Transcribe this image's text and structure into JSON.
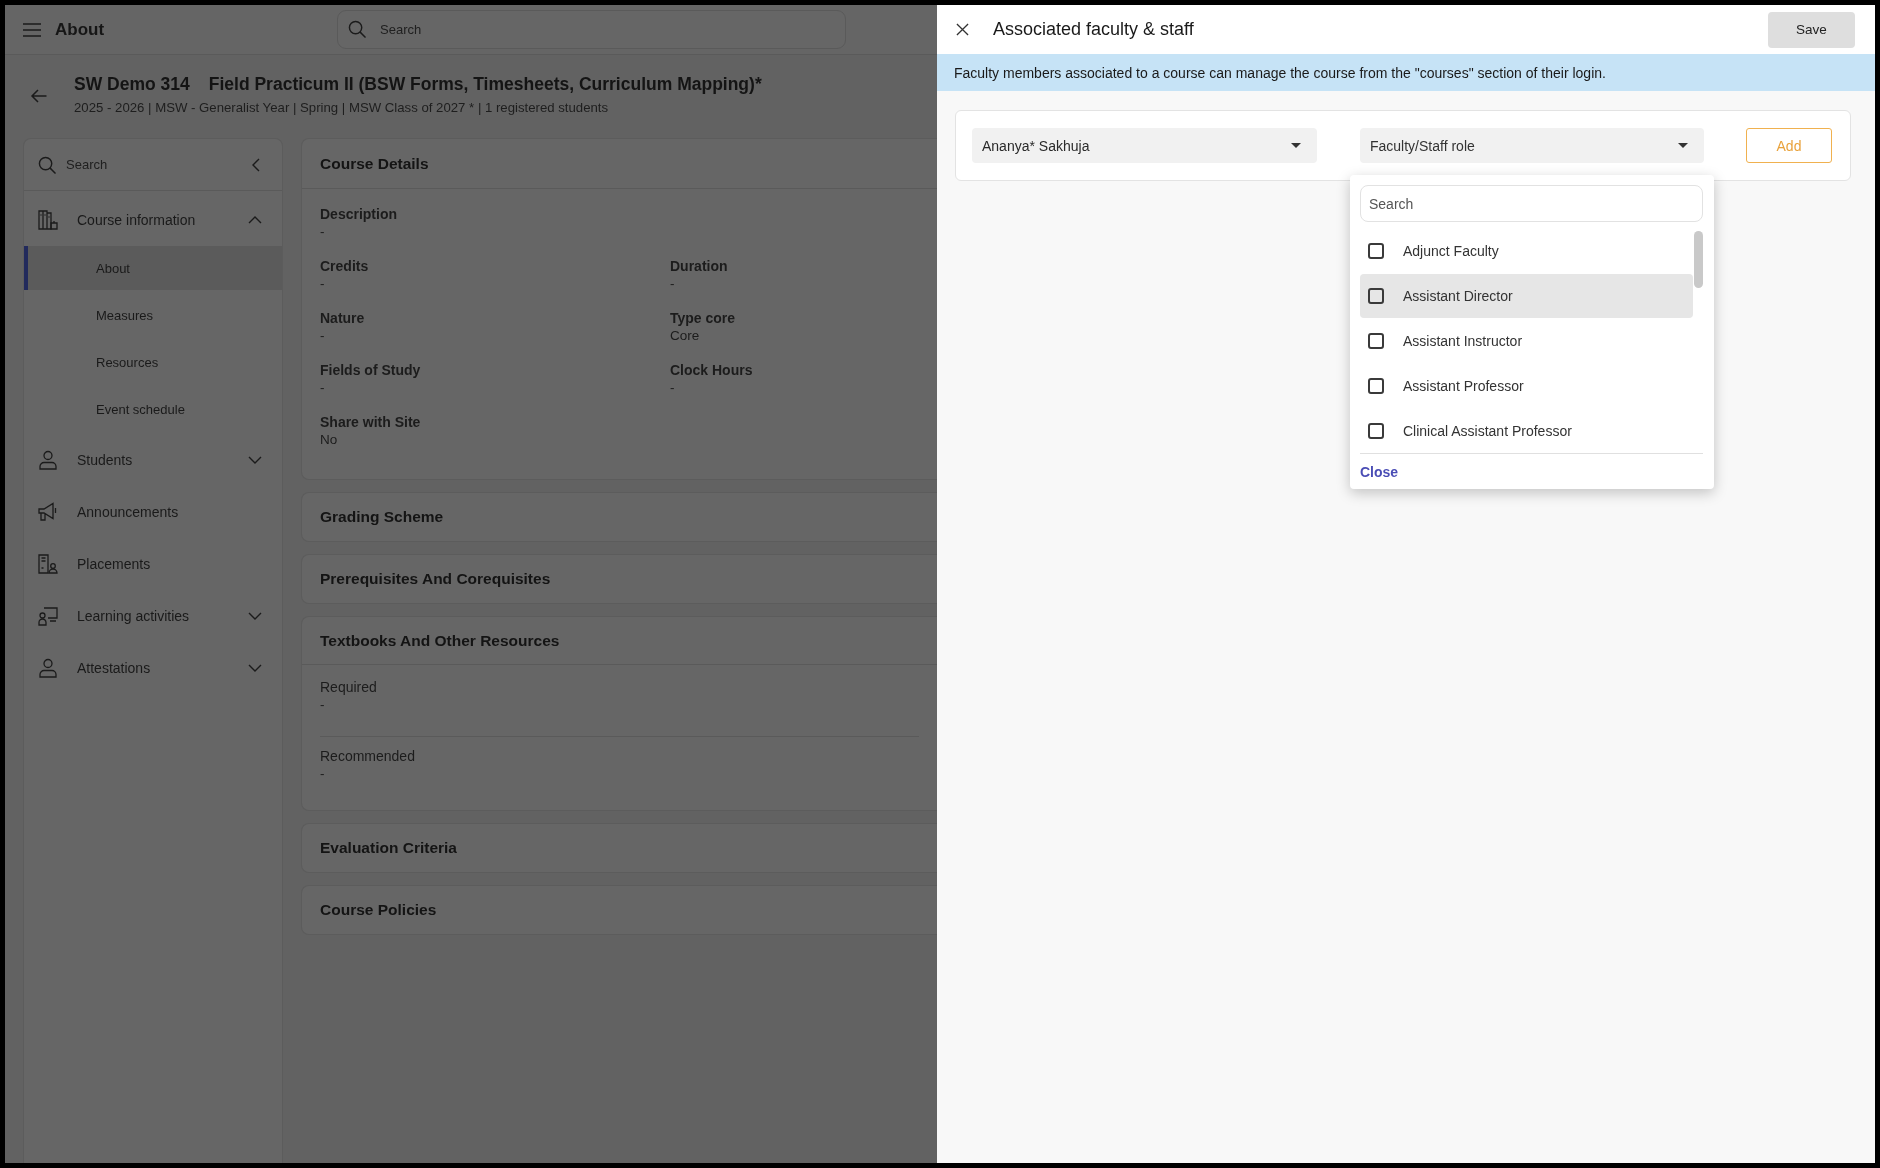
{
  "top_bar": {
    "title": "About",
    "search": {
      "placeholder": "Search"
    }
  },
  "course_header": {
    "code": "SW Demo 314",
    "title": "Field Practicum II (BSW Forms, Timesheets, Curriculum Mapping)*",
    "meta": "2025 - 2026 | MSW - Generalist Year | Spring | MSW Class of 2027 * | 1 registered students"
  },
  "sidebar": {
    "search": {
      "placeholder": "Search"
    },
    "items": [
      {
        "kind": "group",
        "label": "Course information",
        "expanded": true,
        "children": [
          {
            "label": "About",
            "selected": true
          },
          {
            "label": "Measures",
            "selected": false
          },
          {
            "label": "Resources",
            "selected": false
          },
          {
            "label": "Event schedule",
            "selected": false
          }
        ]
      },
      {
        "kind": "group",
        "label": "Students",
        "expanded": false
      },
      {
        "kind": "link",
        "label": "Announcements"
      },
      {
        "kind": "link",
        "label": "Placements"
      },
      {
        "kind": "group",
        "label": "Learning activities",
        "expanded": false
      },
      {
        "kind": "group",
        "label": "Attestations",
        "expanded": false
      }
    ]
  },
  "sections": [
    {
      "kind": "details",
      "title": "Course Details",
      "description": {
        "label": "Description",
        "value": "-"
      },
      "fields": [
        {
          "label": "Credits",
          "value": "-"
        },
        {
          "label": "Duration",
          "value": "-"
        },
        {
          "label": "Nature",
          "value": "-"
        },
        {
          "label": "Type core",
          "value": "Core"
        },
        {
          "label": "Fields of Study",
          "value": "-"
        },
        {
          "label": "Clock Hours",
          "value": "-"
        },
        {
          "label": "Share with Site",
          "value": "No"
        }
      ]
    },
    {
      "kind": "collapsed",
      "title": "Grading Scheme"
    },
    {
      "kind": "collapsed",
      "title": "Prerequisites And Corequisites"
    },
    {
      "kind": "resources",
      "title": "Textbooks And Other Resources",
      "fields": [
        {
          "label": "Required",
          "value": "-"
        },
        {
          "label": "Recommended",
          "value": "-"
        }
      ]
    },
    {
      "kind": "collapsed",
      "title": "Evaluation Criteria"
    },
    {
      "kind": "collapsed",
      "title": "Course Policies"
    }
  ],
  "panel": {
    "title": "Associated faculty & staff",
    "save_button": "Save",
    "info": "Faculty members associated to a course can manage the course from the \"courses\" section of their login.",
    "person_select": {
      "value": "Ananya* Sakhuja"
    },
    "role_select": {
      "placeholder": "Faculty/Staff role"
    },
    "add_button": "Add",
    "role_dropdown": {
      "search": {
        "placeholder": "Search"
      },
      "options": [
        {
          "label": "Adjunct Faculty",
          "checked": false,
          "highlighted": false
        },
        {
          "label": "Assistant Director",
          "checked": false,
          "highlighted": true
        },
        {
          "label": "Assistant Instructor",
          "checked": false,
          "highlighted": false
        },
        {
          "label": "Assistant Professor",
          "checked": false,
          "highlighted": false
        },
        {
          "label": "Clinical Assistant Professor",
          "checked": false,
          "highlighted": false
        }
      ],
      "close_link": "Close"
    }
  }
}
